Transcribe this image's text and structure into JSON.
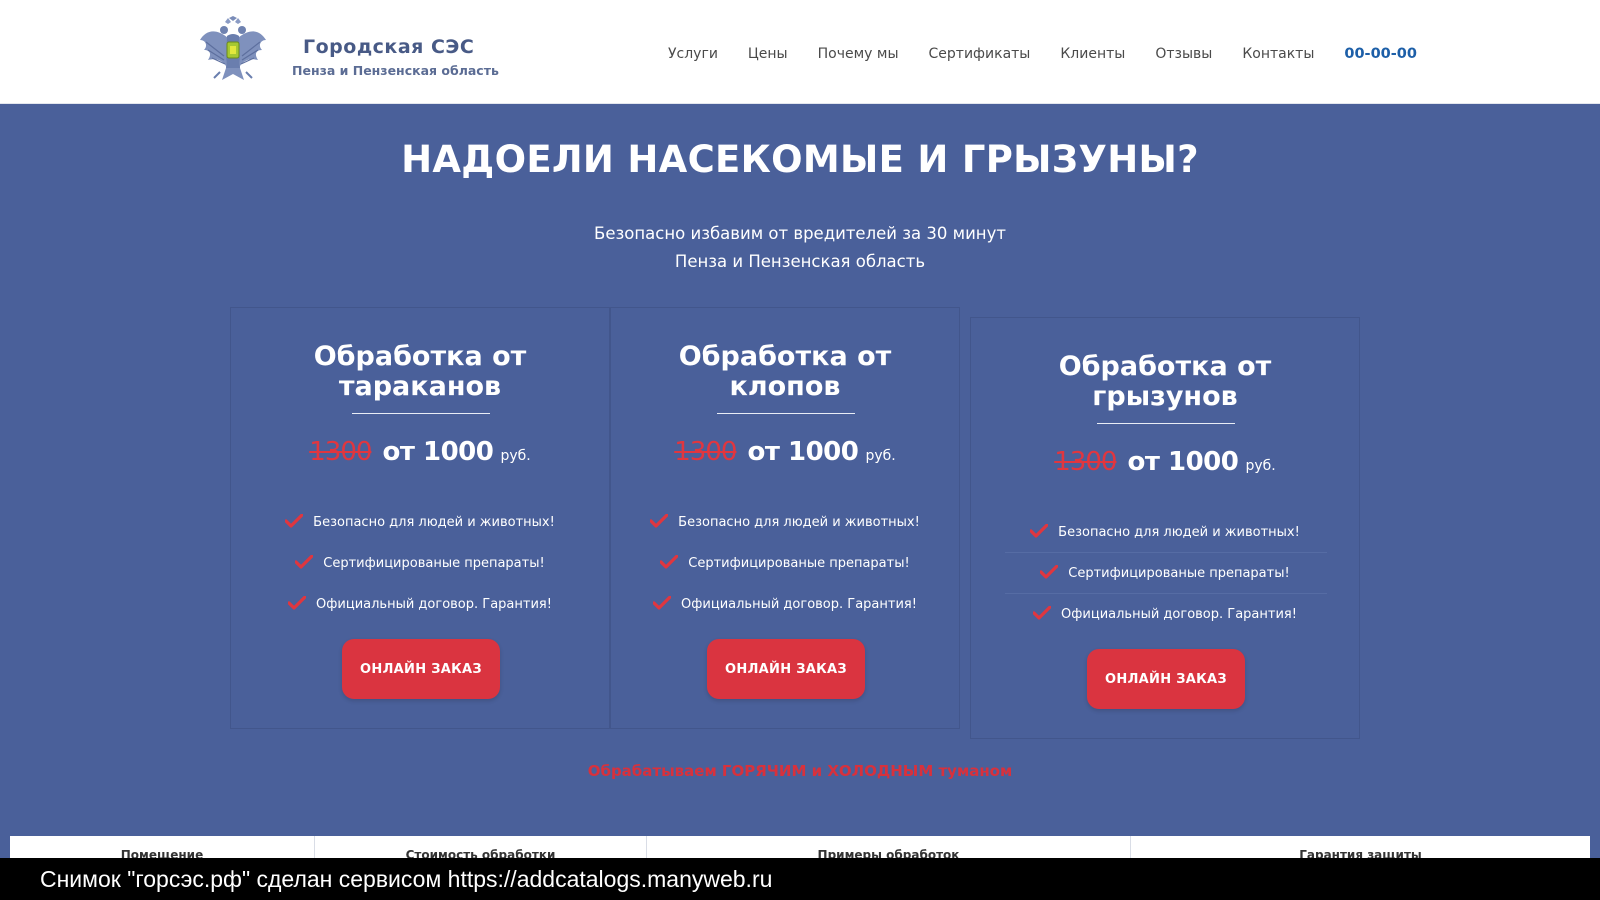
{
  "header": {
    "brand_title": "Городская СЭС",
    "brand_subtitle": "Пенза и Пензенская область",
    "nav": [
      "Услуги",
      "Цены",
      "Почему мы",
      "Сертификаты",
      "Клиенты",
      "Отзывы",
      "Контакты"
    ],
    "phone": "00-00-00",
    "logo_icon": "double-headed-eagle-emblem-icon"
  },
  "hero": {
    "title": "НАДОЕЛИ НАСЕКОМЫЕ И ГРЫЗУНЫ?",
    "subtitle_line1": "Безопасно избавим от вредителей за 30 минут",
    "subtitle_line2": "Пенза и Пензенская область"
  },
  "cards": [
    {
      "title_line1": "Обработка от",
      "title_line2": "тараканов",
      "old_price": "1300",
      "new_price": "от 1000",
      "unit": "руб.",
      "features": [
        "Безопасно для людей и животных!",
        "Сертифицированые препараты!",
        "Официальный договор. Гарантия!"
      ],
      "button": "ОНЛАЙН ЗАКАЗ"
    },
    {
      "title_line1": "Обработка от",
      "title_line2": "клопов",
      "old_price": "1300",
      "new_price": "от 1000",
      "unit": "руб.",
      "features": [
        "Безопасно для людей и животных!",
        "Сертифицированые препараты!",
        "Официальный договор. Гарантия!"
      ],
      "button": "ОНЛАЙН ЗАКАЗ"
    },
    {
      "title_line1": "Обработка от",
      "title_line2": "грызунов",
      "old_price": "1300",
      "new_price": "от 1000",
      "unit": "руб.",
      "features": [
        "Безопасно для людей и животных!",
        "Сертифицированые препараты!",
        "Официальный договор. Гарантия!"
      ],
      "button": "ОНЛАЙН ЗАКАЗ"
    }
  ],
  "fog_text": "Обрабатываем ГОРЯЧИМ и ХОЛОДНЫМ туманом",
  "bottom_tabs": [
    "Помещение",
    "Стоимость обработки",
    "Примеры обработок",
    "Гарантия защиты"
  ],
  "caption": "Снимок \"горсэс.рф\" сделан сервисом https://addcatalogs.manyweb.ru",
  "colors": {
    "page_bg": "#4a609a",
    "accent_red": "#da3440",
    "brand_blue": "#485a86",
    "phone_blue": "#1d5fa8"
  }
}
